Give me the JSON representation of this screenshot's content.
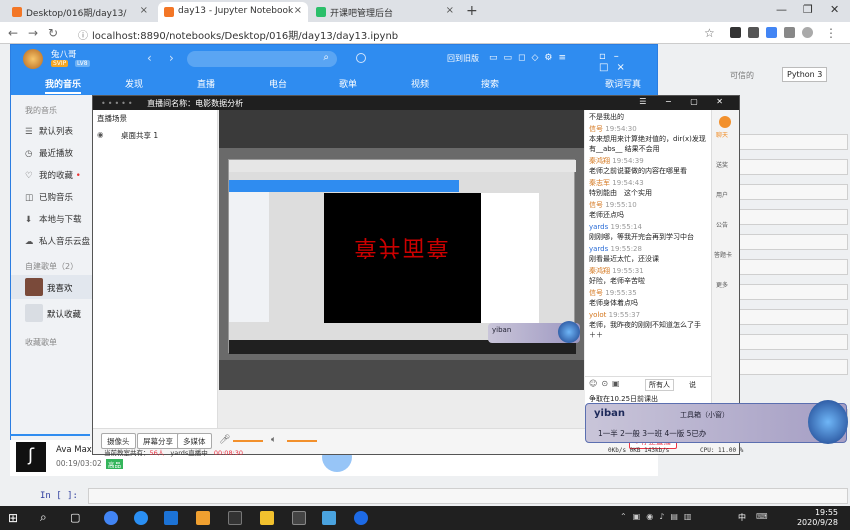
{
  "browser": {
    "tabs": [
      {
        "title": "Desktop/016期/day13/",
        "active": false
      },
      {
        "title": "day13 - Jupyter Notebook",
        "active": true
      },
      {
        "title": "开课吧管理后台",
        "active": false
      }
    ],
    "url": "localhost:8890/notebooks/Desktop/016期/day13/day13.ipynb"
  },
  "jupyter": {
    "trusted": "可信的",
    "kernel": "Python 3",
    "in_prompt": "In [ ]:"
  },
  "music_app": {
    "user": "兔八哥",
    "vip_badges": [
      "SVIP",
      "LV8"
    ],
    "search_placeholder": "",
    "header_link": "回到旧版",
    "nav_tabs": [
      "我的音乐",
      "发现",
      "直播",
      "电台",
      "歌单",
      "视频",
      "搜索"
    ],
    "lyric_btn": "歌词写真",
    "sidebar_section1": "我的音乐",
    "sidebar": [
      "默认列表",
      "最近播放",
      "我的收藏",
      "已购音乐",
      "本地与下载",
      "私人音乐云盘"
    ],
    "sidebar_section2": "自建歌单（2）",
    "playlists": [
      "我喜欢",
      "默认收藏"
    ],
    "sidebar_section3": "收藏歌单",
    "now_playing": "Ava Max",
    "play_time": "00:19/03:02",
    "quality_badge": "高品"
  },
  "live": {
    "title": "直播间名称：电影数据分析",
    "scene_header": "直播场景",
    "scene_item": "桌面共享 1",
    "inner_video_text": "章并面章",
    "chat": [
      {
        "user": "",
        "time": "",
        "msg": "不是我出的"
      },
      {
        "user": "信号",
        "time": "19:54:30",
        "msg": "本来想用来计算绝对值的，dir(x)发现有__abs__ 结果不会用"
      },
      {
        "user": "秦鸿翔",
        "time": "19:54:39",
        "msg": "老师之前说要做的内容在哪里看"
      },
      {
        "user": "秦志军",
        "time": "19:54:43",
        "msg": "特别能由　这个实用"
      },
      {
        "user": "信号",
        "time": "19:55:10",
        "msg": "老师还点吗"
      },
      {
        "user": "yards",
        "time": "19:55:14",
        "msg": "刚刚哪，等我开完会再到学习中台"
      },
      {
        "user": "yards",
        "time": "19:55:28",
        "msg": "刚看最近太忙，还没课"
      },
      {
        "user": "秦鸿翔",
        "time": "19:55:31",
        "msg": "好险，老师辛苦啦"
      },
      {
        "user": "信号",
        "time": "19:55:35",
        "msg": "老师身体着点吗"
      },
      {
        "user": "yolot",
        "time": "19:55:37",
        "msg": "老师，我昨夜的刚刚不知道怎么了手＋＋"
      }
    ],
    "chat_scope": "所有人",
    "chat_send_label": "说",
    "chat_notice": "争取在10.25日前课出",
    "right_tools": [
      "聊天",
      "送奖",
      "用户",
      "公告",
      "答题卡",
      "更多"
    ],
    "footer_buttons": [
      "摄像头",
      "屏幕分享",
      "多媒体"
    ],
    "footer_status_prefix": "当前教室共有：",
    "footer_status_count": "56人",
    "footer_status_user": "yards直播中",
    "footer_timer": "00:08:30",
    "stop_btn": "停止直播",
    "net_status": "CPU: 11.00 %",
    "net_status2": "0Kb/s  0KB  143kb/s"
  },
  "game_overlay": {
    "input_text": "yiban",
    "row1": "工具箱（小窗）",
    "row2": "1一半 2一般 3一班 4一版 5已办"
  },
  "taskbar": {
    "time": "19:55",
    "date": "2020/9/28",
    "ime": "中"
  }
}
